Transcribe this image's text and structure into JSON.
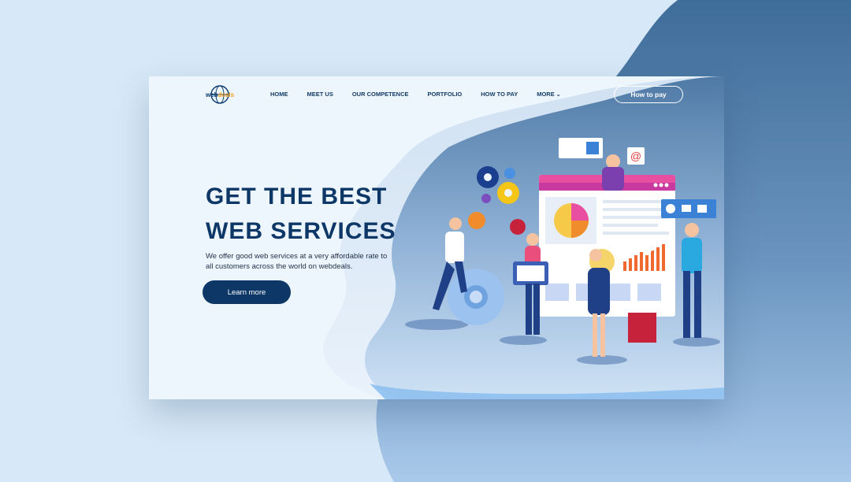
{
  "logo": {
    "part1": "web",
    "part2": "deals"
  },
  "nav": {
    "items": [
      "HOME",
      "MEET US",
      "OUR COMPETENCE",
      "PORTFOLIO",
      "HOW TO PAY",
      "MORE"
    ],
    "more_chevron": "chevron-down-icon"
  },
  "header": {
    "cta_label": "How to pay"
  },
  "hero": {
    "title_line1": "GET THE BEST",
    "title_line2": "WEB SERVICES",
    "subtitle": "We offer good web services at a very affordable rate to all customers across the world on webdeals.",
    "button_label": "Learn more"
  },
  "colors": {
    "navy": "#0d3767",
    "background": "#d7e9f8",
    "card": "#eef6fd",
    "blob_dark": "#4a75a0",
    "accent_orange": "#f0a01c",
    "accent_pink": "#e64a8c"
  }
}
